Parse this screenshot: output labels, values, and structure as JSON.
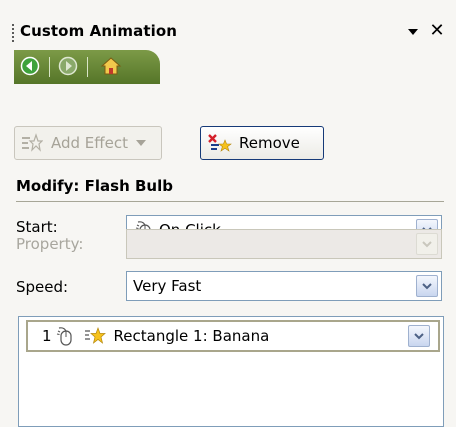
{
  "panel": {
    "title": "Custom Animation"
  },
  "toolbar": {
    "add_effect_label": "Add Effect",
    "remove_label": "Remove"
  },
  "modify": {
    "heading": "Modify: Flash Bulb",
    "start_label": "Start:",
    "start_value": "On Click",
    "property_label": "Property:",
    "property_value": "",
    "speed_label": "Speed:",
    "speed_value": "Very Fast"
  },
  "effects": [
    {
      "number": "1",
      "name": "Rectangle 1: Banana"
    }
  ],
  "colors": {
    "nav_green": "#6a8a37",
    "remove_border": "#163a78",
    "combo_border": "#7f9db9"
  }
}
